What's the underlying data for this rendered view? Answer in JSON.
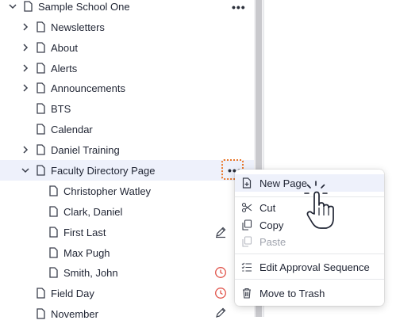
{
  "tree": {
    "root": {
      "label": "Sample School One"
    },
    "items": [
      {
        "label": "Newsletters",
        "expandable": true
      },
      {
        "label": "About",
        "expandable": true
      },
      {
        "label": "Alerts",
        "expandable": true
      },
      {
        "label": "Announcements",
        "expandable": true
      },
      {
        "label": "BTS",
        "expandable": false
      },
      {
        "label": "Calendar",
        "expandable": false
      },
      {
        "label": "Daniel Training",
        "expandable": true
      },
      {
        "label": "Faculty Directory Page",
        "expandable": true,
        "expanded": true,
        "selected": true
      },
      {
        "label": "Christopher Watley",
        "child": true
      },
      {
        "label": "Clark, Daniel",
        "child": true
      },
      {
        "label": "First Last",
        "child": true,
        "status": "edit-icon"
      },
      {
        "label": "Max Pugh",
        "child": true
      },
      {
        "label": "Smith, John",
        "child": true,
        "status": "clock-icon"
      },
      {
        "label": "Field Day",
        "status": "clock-icon"
      },
      {
        "label": "November",
        "status": "edit-icon"
      }
    ]
  },
  "menu": {
    "items": [
      {
        "label": "New Page",
        "icon": "new-page-icon"
      },
      {
        "label": "Cut",
        "icon": "scissors-icon"
      },
      {
        "label": "Copy",
        "icon": "copy-icon"
      },
      {
        "label": "Paste",
        "icon": "paste-icon",
        "disabled": true
      },
      {
        "label": "Edit Approval Sequence",
        "icon": "approval-list-icon"
      },
      {
        "label": "Move to Trash",
        "icon": "trash-icon"
      }
    ]
  },
  "colors": {
    "highlight": "#eef1fb",
    "focus_outline": "#e9772b",
    "clock_status": "#e0534a"
  }
}
